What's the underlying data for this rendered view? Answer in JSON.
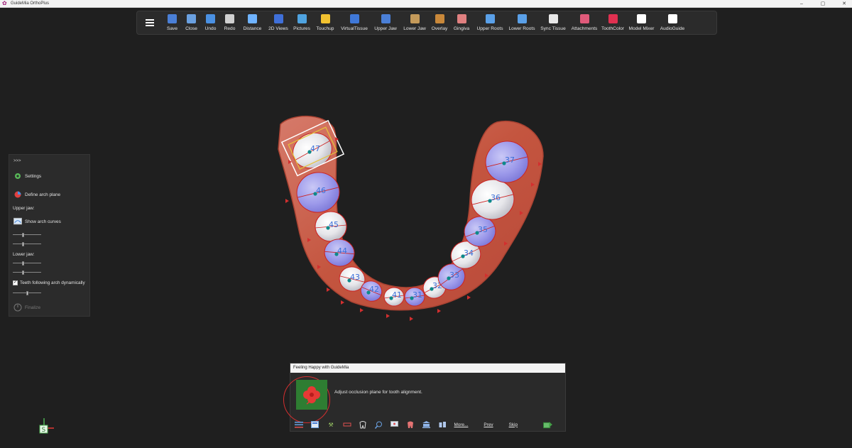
{
  "app": {
    "title": "GuideMia OrthoPlus"
  },
  "window_controls": {
    "minimize": "–",
    "maximize": "▢",
    "close": "✕"
  },
  "toolbar": {
    "items": [
      {
        "label": "Save",
        "icon": "save-icon",
        "color": "#4a7fd6"
      },
      {
        "label": "Close",
        "icon": "close-file-icon",
        "color": "#6aa0e0"
      },
      {
        "label": "Undo",
        "icon": "undo-icon",
        "color": "#4a90e2"
      },
      {
        "label": "Redo",
        "icon": "redo-icon",
        "color": "#d0d0d0"
      },
      {
        "label": "Distance",
        "icon": "ruler-icon",
        "color": "#6fb3ff"
      },
      {
        "label": "2D Views",
        "icon": "2d-views-icon",
        "color": "#3f6fd8"
      },
      {
        "label": "Pictures",
        "icon": "pictures-icon",
        "color": "#4fa3e0"
      },
      {
        "label": "Touchup",
        "icon": "touchup-icon",
        "color": "#f2c230"
      },
      {
        "label": "VirtualTissue",
        "icon": "virtual-tissue-icon",
        "color": "#3f78d8"
      },
      {
        "label": "Upper Jaw",
        "icon": "upper-jaw-icon",
        "color": "#4a7fd6"
      },
      {
        "label": "Lower Jaw",
        "icon": "lower-jaw-icon",
        "color": "#c49a5a"
      },
      {
        "label": "Overlay",
        "icon": "overlay-icon",
        "color": "#c9883a"
      },
      {
        "label": "Gingiva",
        "icon": "gingiva-icon",
        "color": "#e08080"
      },
      {
        "label": "Upper Roots",
        "icon": "upper-roots-icon",
        "color": "#5aa0e8"
      },
      {
        "label": "Lower Roots",
        "icon": "lower-roots-icon",
        "color": "#5aa0e8"
      },
      {
        "label": "Sync Tissue",
        "icon": "sync-tissue-icon",
        "color": "#e8e8e8"
      },
      {
        "label": "Attachments",
        "icon": "attachments-icon",
        "color": "#e05a7a"
      },
      {
        "label": "ToothColor",
        "icon": "tooth-color-icon",
        "color": "#e03050"
      },
      {
        "label": "Model Mixer",
        "icon": "cube-icon",
        "color": "#ffffff"
      },
      {
        "label": "AudioGuide",
        "icon": "microphone-muted-icon",
        "color": "#ffffff"
      }
    ]
  },
  "left_panel": {
    "expand": ">>>",
    "settings": "Settings",
    "define_arch_plane": "Define arch plane",
    "upper_jaw": "Upper jaw:",
    "show_arch_curves": "Show arch curves",
    "lower_jaw": "Lower jaw:",
    "teeth_following": "Teeth following arch dynamically",
    "teeth_following_checked": true,
    "finalize": "Finalize",
    "sliders": [
      0.35,
      0.35,
      0.35,
      0.35,
      0.5
    ]
  },
  "scene": {
    "teeth": [
      {
        "number": "47",
        "color": "white",
        "selected": true
      },
      {
        "number": "46",
        "color": "purple"
      },
      {
        "number": "45",
        "color": "white"
      },
      {
        "number": "44",
        "color": "purple"
      },
      {
        "number": "43",
        "color": "white"
      },
      {
        "number": "42",
        "color": "purple"
      },
      {
        "number": "41",
        "color": "white"
      },
      {
        "number": "31",
        "color": "purple"
      },
      {
        "number": "32",
        "color": "white"
      },
      {
        "number": "33",
        "color": "purple"
      },
      {
        "number": "34",
        "color": "white"
      },
      {
        "number": "35",
        "color": "purple"
      },
      {
        "number": "36",
        "color": "white"
      },
      {
        "number": "37",
        "color": "purple"
      }
    ]
  },
  "dialog": {
    "title": "Feeling Happy with GuideMia",
    "message": "Adjust occlusion plane for tooth alignment.",
    "more": "More...",
    "prev": "Prev",
    "skip": "Skip"
  }
}
